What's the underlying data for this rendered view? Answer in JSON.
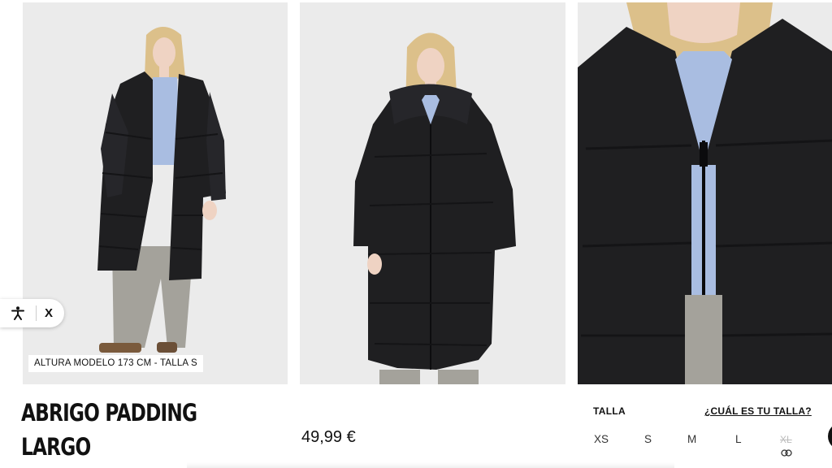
{
  "gallery": {
    "model_info": "ALTURA MODELO 173 CM - TALLA S",
    "images": [
      {
        "alt": "model-full-front-open"
      },
      {
        "alt": "model-full-front-closed"
      },
      {
        "alt": "model-closeup-zipper"
      }
    ]
  },
  "accessibility_widget": {
    "icon": "accessibility-person-icon",
    "close_label": "X"
  },
  "product": {
    "title": "ABRIGO PADDING LARGO",
    "price": "49,99 €"
  },
  "sizes": {
    "label": "TALLA",
    "guide_link": "¿CUÁL ES TU TALLA?",
    "options": [
      {
        "label": "XS",
        "available": true
      },
      {
        "label": "S",
        "available": true
      },
      {
        "label": "M",
        "available": true
      },
      {
        "label": "L",
        "available": true
      },
      {
        "label": "XL",
        "available": false
      }
    ]
  },
  "colors": {
    "photo_bg": "#ebebeb",
    "coat": "#1f1f21",
    "shirt": "#a9bde1",
    "jeans": "#a4a29b",
    "hair": "#dcc08a",
    "skin": "#efd3c3"
  }
}
